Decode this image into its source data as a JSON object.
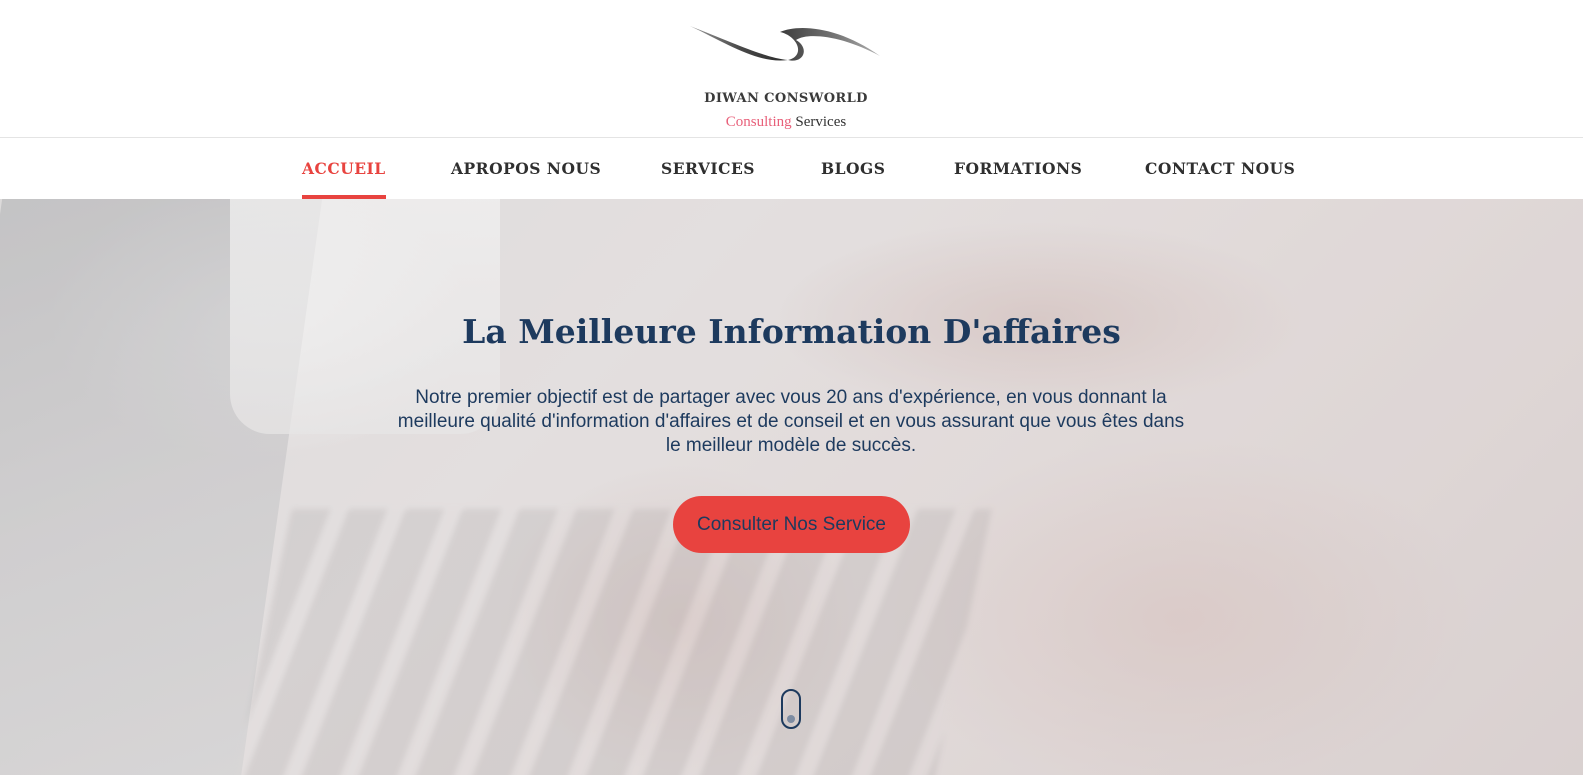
{
  "brand": {
    "name": "DIWAN CONSWORLD",
    "tagline_accent": "Consulting",
    "tagline_rest": "Services",
    "logo_icon": "swoosh-logo-icon"
  },
  "nav": {
    "items": [
      {
        "label": "ACCUEIL",
        "active": true
      },
      {
        "label": "APROPOS NOUS",
        "active": false
      },
      {
        "label": "SERVICES",
        "active": false
      },
      {
        "label": "BLOGS",
        "active": false
      },
      {
        "label": "FORMATIONS",
        "active": false
      },
      {
        "label": "CONTACT NOUS",
        "active": false
      }
    ]
  },
  "hero": {
    "title": "La Meilleure Information D'affaires",
    "description": "Notre premier objectif est de partager avec vous 20 ans d'expérience, en vous donnant la meilleure qualité d'information d'affaires et de conseil et en vous assurant que vous êtes dans le meilleur modèle de succès.",
    "cta_label": "Consulter Nos Service",
    "scroll_icon": "mouse-scroll-icon"
  },
  "colors": {
    "accent": "#e8433f",
    "primary_text": "#1d3a5e",
    "brand_pink": "#e8607a",
    "nav_text": "#2f2f2f"
  }
}
